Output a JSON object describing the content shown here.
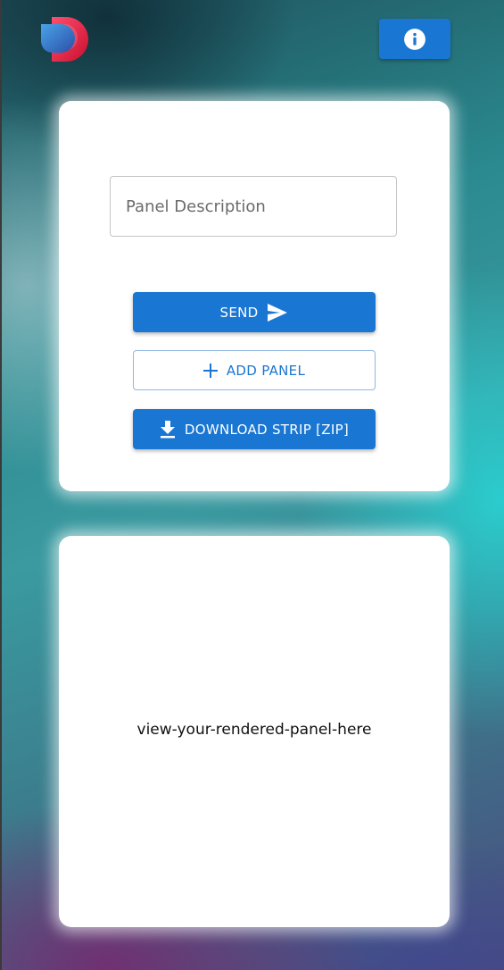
{
  "header": {
    "logo_icon": "app-logo-icon",
    "info_button_icon": "info-icon"
  },
  "form": {
    "description_placeholder": "Panel Description",
    "description_value": "",
    "send_label": "SEND",
    "send_icon": "send-icon",
    "add_panel_label": "ADD PANEL",
    "add_panel_icon": "plus-icon",
    "download_label": "DOWNLOAD STRIP [ZIP]",
    "download_icon": "download-icon"
  },
  "preview": {
    "placeholder_text": "view-your-rendered-panel-here"
  },
  "colors": {
    "primary": "#1976d2",
    "card_background": "#ffffff"
  }
}
